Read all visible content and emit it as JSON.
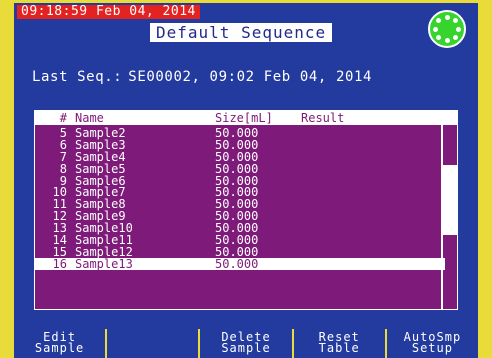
{
  "header": {
    "clock": "09:18:59 Feb 04, 2014",
    "title": "Default Sequence",
    "status_icon": "gear-status-icon"
  },
  "last_sequence": {
    "label": "Last Seq.:",
    "value": "SE00002, 09:02 Feb 04, 2014"
  },
  "table": {
    "columns": [
      "#",
      "Name",
      "Size[mL]",
      "Result"
    ],
    "rows": [
      {
        "num": "5",
        "name": "Sample2",
        "size": "50.000",
        "result": ""
      },
      {
        "num": "6",
        "name": "Sample3",
        "size": "50.000",
        "result": ""
      },
      {
        "num": "7",
        "name": "Sample4",
        "size": "50.000",
        "result": ""
      },
      {
        "num": "8",
        "name": "Sample5",
        "size": "50.000",
        "result": ""
      },
      {
        "num": "9",
        "name": "Sample6",
        "size": "50.000",
        "result": ""
      },
      {
        "num": "10",
        "name": "Sample7",
        "size": "50.000",
        "result": ""
      },
      {
        "num": "11",
        "name": "Sample8",
        "size": "50.000",
        "result": ""
      },
      {
        "num": "12",
        "name": "Sample9",
        "size": "50.000",
        "result": ""
      },
      {
        "num": "13",
        "name": "Sample10",
        "size": "50.000",
        "result": ""
      },
      {
        "num": "14",
        "name": "Sample11",
        "size": "50.000",
        "result": ""
      },
      {
        "num": "15",
        "name": "Sample12",
        "size": "50.000",
        "result": ""
      },
      {
        "num": "16",
        "name": "Sample13",
        "size": "50.000",
        "result": ""
      }
    ],
    "selected_row_index": 11
  },
  "softkeys": [
    {
      "id": "edit-sample",
      "label": "Edit\nSample"
    },
    {
      "id": "blank",
      "label": ""
    },
    {
      "id": "delete-sample",
      "label": "Delete\nSample"
    },
    {
      "id": "reset-table",
      "label": "Reset\nTable"
    },
    {
      "id": "autosmp-setup",
      "label": "AutoSmp\nSetup"
    }
  ],
  "colors": {
    "background": "#233a9e",
    "table_bg": "#7e1a79",
    "clock_bg": "#e32222",
    "status_icon": "#36d42c",
    "bezel": "#e9dc3a"
  }
}
